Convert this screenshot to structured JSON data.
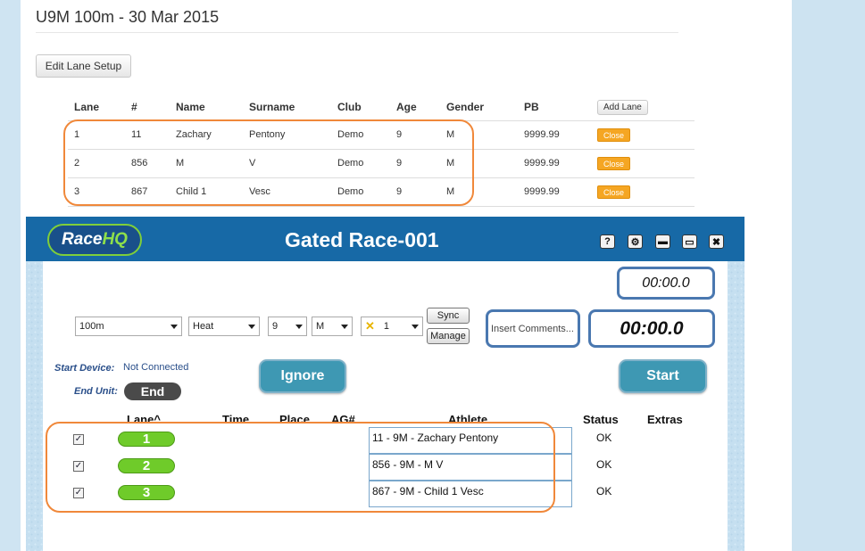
{
  "page": {
    "title": "U9M 100m - 30 Mar 2015",
    "edit_lane_setup": "Edit Lane Setup"
  },
  "lane_table": {
    "headers": [
      "Lane",
      "#",
      "Name",
      "Surname",
      "Club",
      "Age",
      "Gender",
      "PB"
    ],
    "add_lane": "Add Lane",
    "close_label": "Close",
    "rows": [
      [
        "1",
        "11",
        "Zachary",
        "Pentony",
        "Demo",
        "9",
        "M",
        "9999.99"
      ],
      [
        "2",
        "856",
        "M",
        "V",
        "Demo",
        "9",
        "M",
        "9999.99"
      ],
      [
        "3",
        "867",
        "Child 1",
        "Vesc",
        "Demo",
        "9",
        "M",
        "9999.99"
      ]
    ]
  },
  "racehq": {
    "logo_race": "Race",
    "logo_hq": "HQ",
    "title": "Gated Race-001",
    "window_buttons": [
      "help-icon",
      "gear-icon",
      "minimize-icon",
      "maximize-icon",
      "close-icon"
    ],
    "window_glyphs": [
      "?",
      "⚙",
      "▬",
      "▭",
      "✖"
    ],
    "timer_small": "00:00.0",
    "timer_big": "00:00.0",
    "event": "100m",
    "round": "Heat",
    "age": "9",
    "gender": "M",
    "heat_number": "1",
    "x_glyph": "✕",
    "sync": "Sync",
    "manage": "Manage",
    "comments_placeholder": "Insert Comments...",
    "start_device_label": "Start Device:",
    "start_device_value": "Not Connected",
    "end_unit_label": "End Unit:",
    "end_button": "End",
    "ignore_button": "Ignore",
    "start_button": "Start",
    "columns": [
      "Lane^",
      "Time",
      "Place",
      "AG#",
      "Athlete",
      "Status",
      "Extras"
    ],
    "checkbox_glyph": "✓",
    "rows": [
      {
        "lane": "1",
        "athlete": "11 - 9M - Zachary Pentony",
        "status": "OK"
      },
      {
        "lane": "2",
        "athlete": "856 - 9M - M V",
        "status": "OK"
      },
      {
        "lane": "3",
        "athlete": "867 - 9M - Child 1 Vesc",
        "status": "OK"
      }
    ]
  },
  "colors": {
    "accent_orange": "#f5a623",
    "header_blue": "#1769a6",
    "lane_green": "#6fcb2a",
    "teal_button": "#3e98b3"
  }
}
